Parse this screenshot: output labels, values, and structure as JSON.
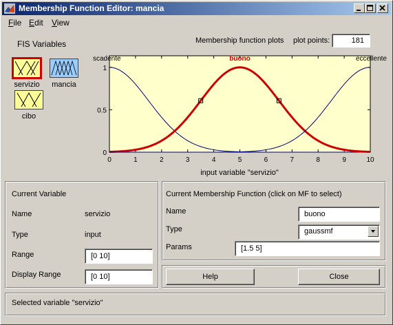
{
  "window": {
    "title": "Membership Function Editor: mancia"
  },
  "menu": {
    "file": "File",
    "file_ul": "F",
    "file_rest": "ile",
    "edit_ul": "E",
    "edit_rest": "dit",
    "view_ul": "V",
    "view_rest": "iew"
  },
  "fis": {
    "title": "FIS Variables",
    "variables": [
      {
        "label": "servizio",
        "selected": true,
        "color": "#ffff99"
      },
      {
        "label": "mancia",
        "selected": false,
        "color": "#99ccff"
      },
      {
        "label": "cibo",
        "selected": false,
        "color": "#ffff99"
      }
    ]
  },
  "plot": {
    "header": "Membership function plots",
    "points_label": "plot points:",
    "points_value": "181",
    "mf_labels": [
      "scadente",
      "buono",
      "eccellente"
    ],
    "x_title": "input variable \"servizio\"",
    "x_ticks": [
      "0",
      "1",
      "2",
      "3",
      "4",
      "5",
      "6",
      "7",
      "8",
      "9",
      "10"
    ],
    "y_ticks": [
      "0",
      "0.5",
      "1"
    ],
    "colors": {
      "background": "#ffffcc",
      "selected": "#cc0000",
      "other": "#000080"
    }
  },
  "chart_data": {
    "type": "line",
    "xlim": [
      0,
      10
    ],
    "ylim": [
      0,
      1
    ],
    "xlabel": "input variable \"servizio\"",
    "series": [
      {
        "name": "scadente",
        "function": "gaussmf",
        "sigma": 1.5,
        "center": 0
      },
      {
        "name": "buono",
        "function": "gaussmf",
        "sigma": 1.5,
        "center": 5,
        "selected": true
      },
      {
        "name": "eccellente",
        "function": "gaussmf",
        "sigma": 1.5,
        "center": 10
      }
    ]
  },
  "current_variable": {
    "title": "Current Variable",
    "name_label": "Name",
    "name_value": "servizio",
    "type_label": "Type",
    "type_value": "input",
    "range_label": "Range",
    "range_value": "[0 10]",
    "display_range_label": "Display Range",
    "display_range_value": "[0 10]"
  },
  "current_mf": {
    "title": "Current Membership Function (click on MF to select)",
    "name_label": "Name",
    "name_value": "buono",
    "type_label": "Type",
    "type_value": "gaussmf",
    "params_label": "Params",
    "params_value": "[1.5 5]"
  },
  "buttons": {
    "help": "Help",
    "close": "Close"
  },
  "status": {
    "text": "Selected variable \"servizio\""
  }
}
